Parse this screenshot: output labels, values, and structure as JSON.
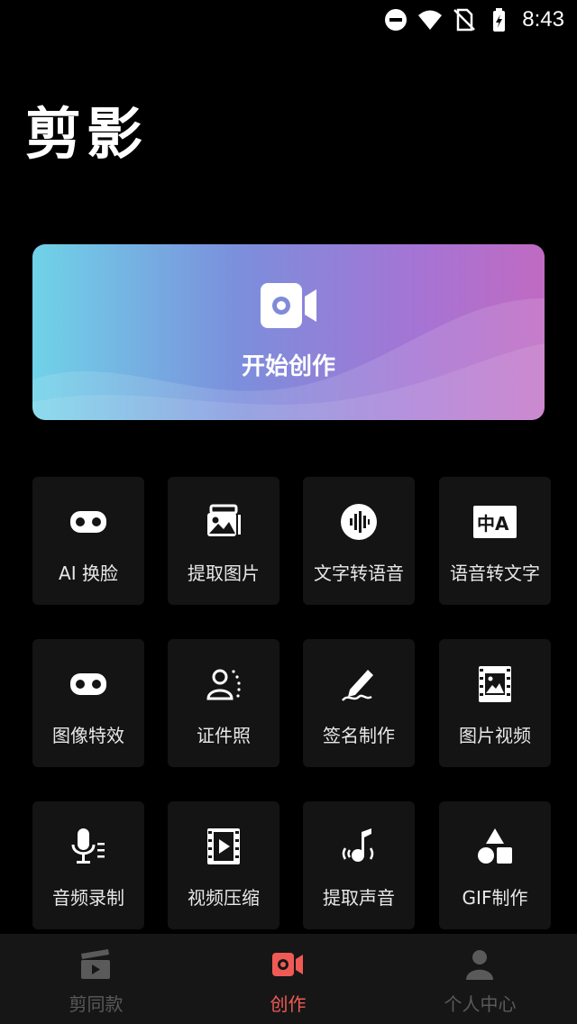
{
  "status_bar": {
    "time": "8:43",
    "icons": [
      "dnd-icon",
      "wifi-icon",
      "no-sim-icon",
      "battery-charging-icon"
    ]
  },
  "app": {
    "title": "剪影"
  },
  "hero": {
    "label": "开始创作",
    "icon": "video-camera-icon",
    "gradient": [
      "#6fd3e8",
      "#7b8fdc",
      "#a574d4",
      "#c06ac2"
    ]
  },
  "tools": [
    {
      "label": "AI 换脸",
      "icon": "vr-glasses-icon"
    },
    {
      "label": "提取图片",
      "icon": "extract-image-icon"
    },
    {
      "label": "文字转语音",
      "icon": "sound-wave-icon"
    },
    {
      "label": "语音转文字",
      "icon": "translate-icon"
    },
    {
      "label": "图像特效",
      "icon": "effects-glasses-icon"
    },
    {
      "label": "证件照",
      "icon": "id-photo-icon"
    },
    {
      "label": "签名制作",
      "icon": "signature-pen-icon"
    },
    {
      "label": "图片视频",
      "icon": "photo-film-icon"
    },
    {
      "label": "音频录制",
      "icon": "microphone-icon"
    },
    {
      "label": "视频压缩",
      "icon": "film-play-icon"
    },
    {
      "label": "提取声音",
      "icon": "music-note-icon"
    },
    {
      "label": "GIF制作",
      "icon": "shapes-icon"
    }
  ],
  "bottom_nav": {
    "items": [
      {
        "label": "剪同款",
        "icon": "clapperboard-icon",
        "active": false
      },
      {
        "label": "创作",
        "icon": "record-icon",
        "active": true
      },
      {
        "label": "个人中心",
        "icon": "person-icon",
        "active": false
      }
    ],
    "active_color": "#f05a55",
    "inactive_color": "#5a5a5a"
  }
}
